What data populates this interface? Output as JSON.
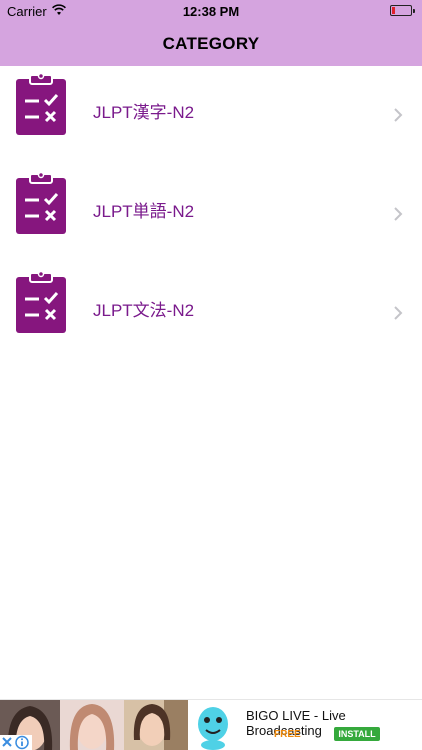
{
  "status": {
    "carrier": "Carrier",
    "time": "12:38 PM",
    "battery_level": 0.1
  },
  "nav": {
    "title": "CATEGORY"
  },
  "categories": [
    {
      "label": "JLPT漢字-N2",
      "icon": "clipboard-checklist-icon"
    },
    {
      "label": "JLPT単語-N2",
      "icon": "clipboard-checklist-icon"
    },
    {
      "label": "JLPT文法-N2",
      "icon": "clipboard-checklist-icon"
    }
  ],
  "ad": {
    "title": "BIGO LIVE - Live Broadcasting",
    "free": "FREE",
    "install": "INSTALL",
    "app_icon": "bigo-live-mascot-icon"
  },
  "colors": {
    "nav_bg": "#d5a4df",
    "accent": "#7a1a8c",
    "icon_bg": "#86167e",
    "free": "#f08a0a",
    "install": "#35a93c"
  }
}
